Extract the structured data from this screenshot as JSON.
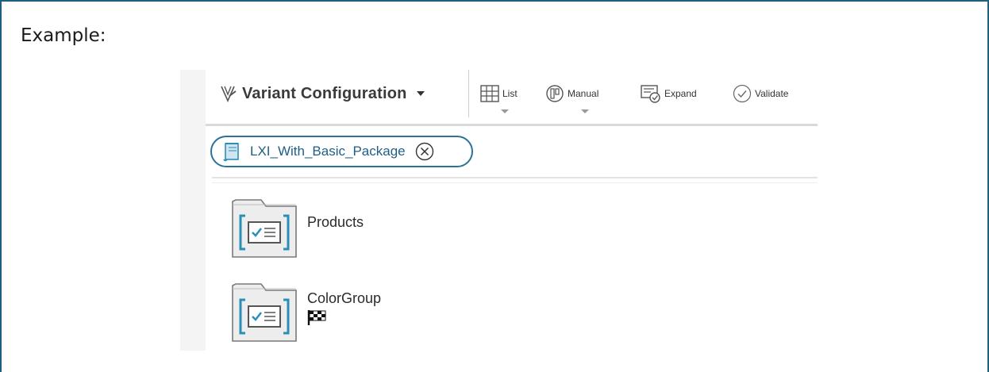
{
  "caption": {
    "label": "Example:"
  },
  "toolbar": {
    "variant_configuration": {
      "label": "Variant Configuration",
      "icon": "variant-configuration-icon"
    },
    "list": {
      "label": "List",
      "icon": "grid-icon"
    },
    "manual": {
      "label": "Manual",
      "icon": "manual-mode-icon"
    },
    "expand": {
      "label": "Expand",
      "icon": "expand-icon"
    },
    "validate": {
      "label": "Validate",
      "icon": "checkmark-circle-icon"
    }
  },
  "filter_chip": {
    "label": "LXI_With_Basic_Package",
    "icon": "scroll-document-icon",
    "close_icon": "close-circle-icon"
  },
  "tree": {
    "items": [
      {
        "label": "Products",
        "icon": "option-family-folder-icon"
      },
      {
        "label": "ColorGroup",
        "icon": "option-family-folder-icon",
        "badge_icon": "checkered-flag-icon"
      }
    ]
  },
  "colors": {
    "frame_border": "#1f5f7f",
    "chip_border": "#2a7397",
    "chip_text": "#1f5f85",
    "icon_teal": "#2a8fb8"
  }
}
